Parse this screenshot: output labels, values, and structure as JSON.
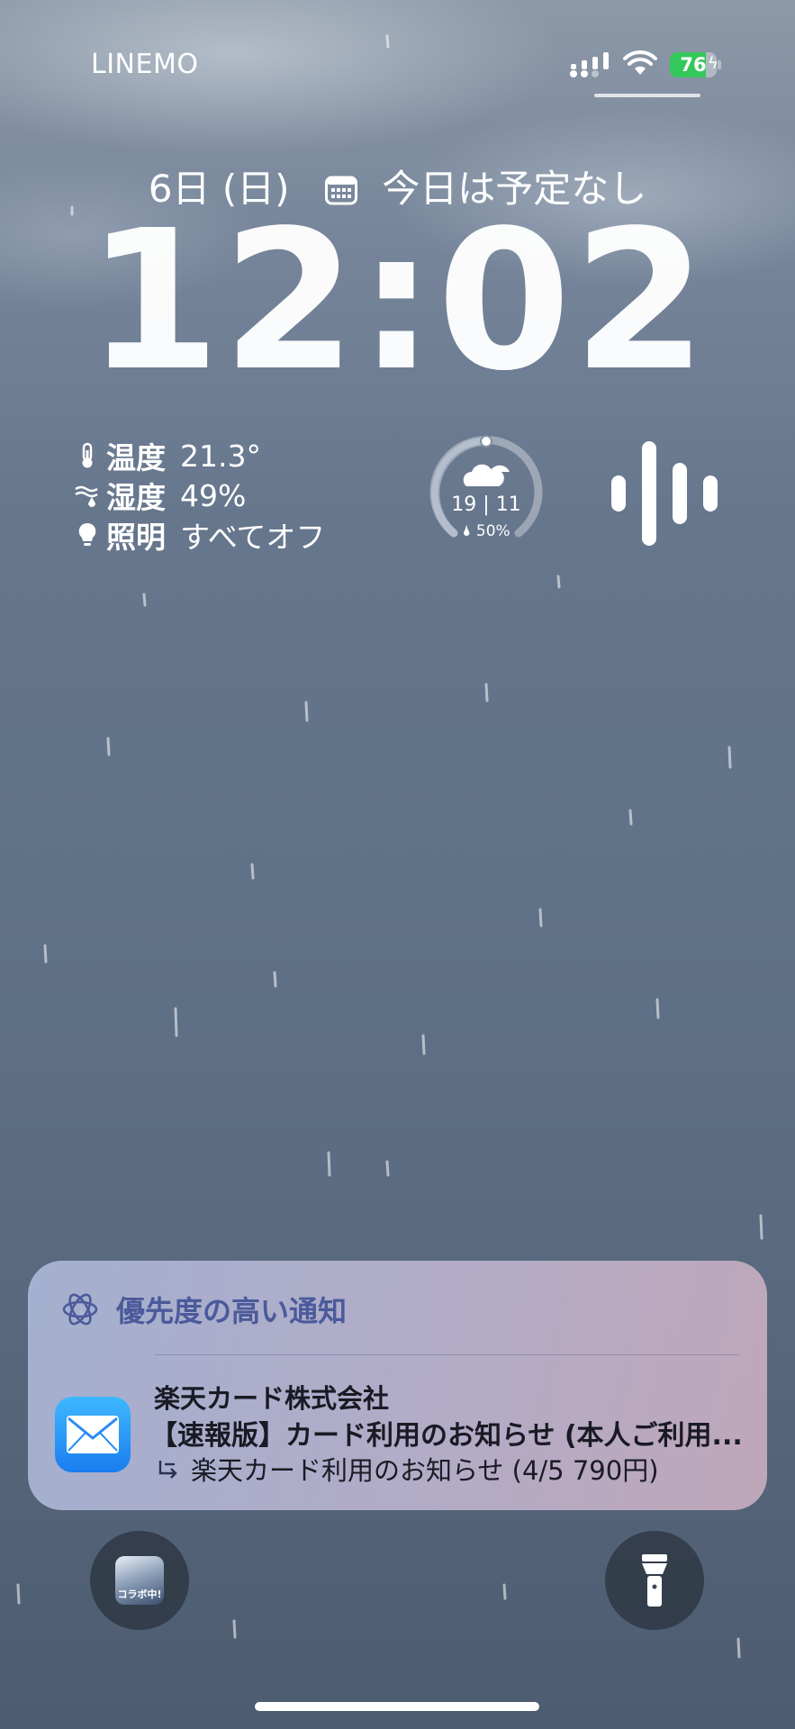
{
  "status_bar": {
    "carrier": "LINEMO",
    "battery_percent": "76",
    "battery_level": 0.76,
    "battery_color": "#34c759",
    "icons": [
      "signal-icon",
      "wifi-icon",
      "battery-charging-icon"
    ]
  },
  "lock_screen": {
    "date": "6日 (日)",
    "calendar_status": "今日は予定なし",
    "time": "12:02"
  },
  "home_widget": {
    "rows": [
      {
        "icon": "thermometer-icon",
        "label": "温度",
        "value": "21.3°"
      },
      {
        "icon": "humidity-icon",
        "label": "湿度",
        "value": "49%"
      },
      {
        "icon": "lightbulb-icon",
        "label": "照明",
        "value": "すべてオフ"
      }
    ]
  },
  "weather_widget": {
    "icon": "cloud-umbrella-icon",
    "high": "19",
    "low": "11",
    "temps_text": "19 | 11",
    "rain_chance": "50%"
  },
  "notification": {
    "header": "優先度の高い通知",
    "app_icon": "mail-icon",
    "sender": "楽天カード株式会社",
    "subject": "【速報版】カード利用のお知らせ (本人ご利用...",
    "preview": "楽天カード利用のお知らせ (4/5 790円)"
  },
  "shortcuts": {
    "left_app_label": "コラボ中!",
    "right": "flashlight-icon"
  }
}
